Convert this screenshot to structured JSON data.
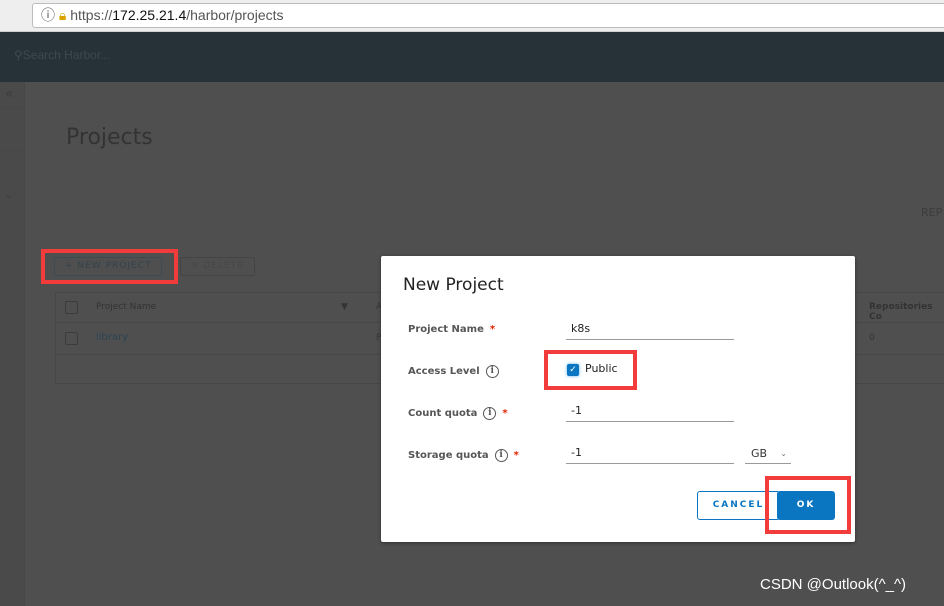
{
  "browser": {
    "url_scheme": "https://",
    "url_host": "172.25.21.4",
    "url_path": "/harbor/projects"
  },
  "header": {
    "search_placeholder": "Search Harbor..."
  },
  "page": {
    "title": "Projects",
    "right_label": "REP",
    "new_project": "+ NEW PROJECT",
    "delete": "✕ DELETE"
  },
  "grid": {
    "columns": [
      "Project Name",
      "A",
      "Repositories Co"
    ],
    "rows": [
      {
        "name": "library",
        "access": "P",
        "repos": "0"
      }
    ]
  },
  "modal": {
    "title": "New Project",
    "project_name_label": "Project Name",
    "project_name_value": "k8s",
    "access_level_label": "Access Level",
    "public_label": "Public",
    "public_checked": true,
    "count_quota_label": "Count quota",
    "count_quota_value": "-1",
    "storage_quota_label": "Storage quota",
    "storage_quota_value": "-1",
    "storage_unit": "GB",
    "cancel": "CANCEL",
    "ok": "OK"
  },
  "watermark": "CSDN @Outlook(^_^)",
  "colors": {
    "primary": "#0a76c1",
    "highlight": "#f23b3b",
    "header": "#273238"
  }
}
